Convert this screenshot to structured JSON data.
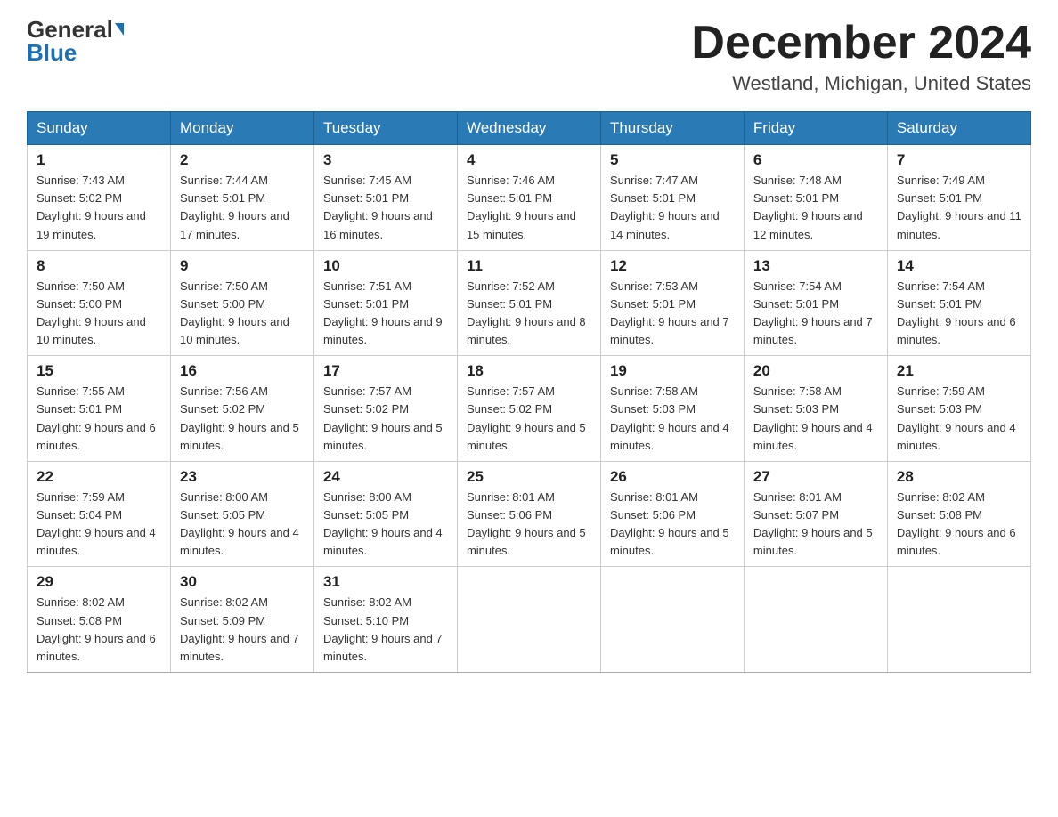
{
  "header": {
    "logo_general": "General",
    "logo_blue": "Blue",
    "month_title": "December 2024",
    "location": "Westland, Michigan, United States"
  },
  "days_of_week": [
    "Sunday",
    "Monday",
    "Tuesday",
    "Wednesday",
    "Thursday",
    "Friday",
    "Saturday"
  ],
  "weeks": [
    [
      {
        "day": "1",
        "sunrise": "7:43 AM",
        "sunset": "5:02 PM",
        "daylight": "9 hours and 19 minutes."
      },
      {
        "day": "2",
        "sunrise": "7:44 AM",
        "sunset": "5:01 PM",
        "daylight": "9 hours and 17 minutes."
      },
      {
        "day": "3",
        "sunrise": "7:45 AM",
        "sunset": "5:01 PM",
        "daylight": "9 hours and 16 minutes."
      },
      {
        "day": "4",
        "sunrise": "7:46 AM",
        "sunset": "5:01 PM",
        "daylight": "9 hours and 15 minutes."
      },
      {
        "day": "5",
        "sunrise": "7:47 AM",
        "sunset": "5:01 PM",
        "daylight": "9 hours and 14 minutes."
      },
      {
        "day": "6",
        "sunrise": "7:48 AM",
        "sunset": "5:01 PM",
        "daylight": "9 hours and 12 minutes."
      },
      {
        "day": "7",
        "sunrise": "7:49 AM",
        "sunset": "5:01 PM",
        "daylight": "9 hours and 11 minutes."
      }
    ],
    [
      {
        "day": "8",
        "sunrise": "7:50 AM",
        "sunset": "5:00 PM",
        "daylight": "9 hours and 10 minutes."
      },
      {
        "day": "9",
        "sunrise": "7:50 AM",
        "sunset": "5:00 PM",
        "daylight": "9 hours and 10 minutes."
      },
      {
        "day": "10",
        "sunrise": "7:51 AM",
        "sunset": "5:01 PM",
        "daylight": "9 hours and 9 minutes."
      },
      {
        "day": "11",
        "sunrise": "7:52 AM",
        "sunset": "5:01 PM",
        "daylight": "9 hours and 8 minutes."
      },
      {
        "day": "12",
        "sunrise": "7:53 AM",
        "sunset": "5:01 PM",
        "daylight": "9 hours and 7 minutes."
      },
      {
        "day": "13",
        "sunrise": "7:54 AM",
        "sunset": "5:01 PM",
        "daylight": "9 hours and 7 minutes."
      },
      {
        "day": "14",
        "sunrise": "7:54 AM",
        "sunset": "5:01 PM",
        "daylight": "9 hours and 6 minutes."
      }
    ],
    [
      {
        "day": "15",
        "sunrise": "7:55 AM",
        "sunset": "5:01 PM",
        "daylight": "9 hours and 6 minutes."
      },
      {
        "day": "16",
        "sunrise": "7:56 AM",
        "sunset": "5:02 PM",
        "daylight": "9 hours and 5 minutes."
      },
      {
        "day": "17",
        "sunrise": "7:57 AM",
        "sunset": "5:02 PM",
        "daylight": "9 hours and 5 minutes."
      },
      {
        "day": "18",
        "sunrise": "7:57 AM",
        "sunset": "5:02 PM",
        "daylight": "9 hours and 5 minutes."
      },
      {
        "day": "19",
        "sunrise": "7:58 AM",
        "sunset": "5:03 PM",
        "daylight": "9 hours and 4 minutes."
      },
      {
        "day": "20",
        "sunrise": "7:58 AM",
        "sunset": "5:03 PM",
        "daylight": "9 hours and 4 minutes."
      },
      {
        "day": "21",
        "sunrise": "7:59 AM",
        "sunset": "5:03 PM",
        "daylight": "9 hours and 4 minutes."
      }
    ],
    [
      {
        "day": "22",
        "sunrise": "7:59 AM",
        "sunset": "5:04 PM",
        "daylight": "9 hours and 4 minutes."
      },
      {
        "day": "23",
        "sunrise": "8:00 AM",
        "sunset": "5:05 PM",
        "daylight": "9 hours and 4 minutes."
      },
      {
        "day": "24",
        "sunrise": "8:00 AM",
        "sunset": "5:05 PM",
        "daylight": "9 hours and 4 minutes."
      },
      {
        "day": "25",
        "sunrise": "8:01 AM",
        "sunset": "5:06 PM",
        "daylight": "9 hours and 5 minutes."
      },
      {
        "day": "26",
        "sunrise": "8:01 AM",
        "sunset": "5:06 PM",
        "daylight": "9 hours and 5 minutes."
      },
      {
        "day": "27",
        "sunrise": "8:01 AM",
        "sunset": "5:07 PM",
        "daylight": "9 hours and 5 minutes."
      },
      {
        "day": "28",
        "sunrise": "8:02 AM",
        "sunset": "5:08 PM",
        "daylight": "9 hours and 6 minutes."
      }
    ],
    [
      {
        "day": "29",
        "sunrise": "8:02 AM",
        "sunset": "5:08 PM",
        "daylight": "9 hours and 6 minutes."
      },
      {
        "day": "30",
        "sunrise": "8:02 AM",
        "sunset": "5:09 PM",
        "daylight": "9 hours and 7 minutes."
      },
      {
        "day": "31",
        "sunrise": "8:02 AM",
        "sunset": "5:10 PM",
        "daylight": "9 hours and 7 minutes."
      },
      null,
      null,
      null,
      null
    ]
  ]
}
